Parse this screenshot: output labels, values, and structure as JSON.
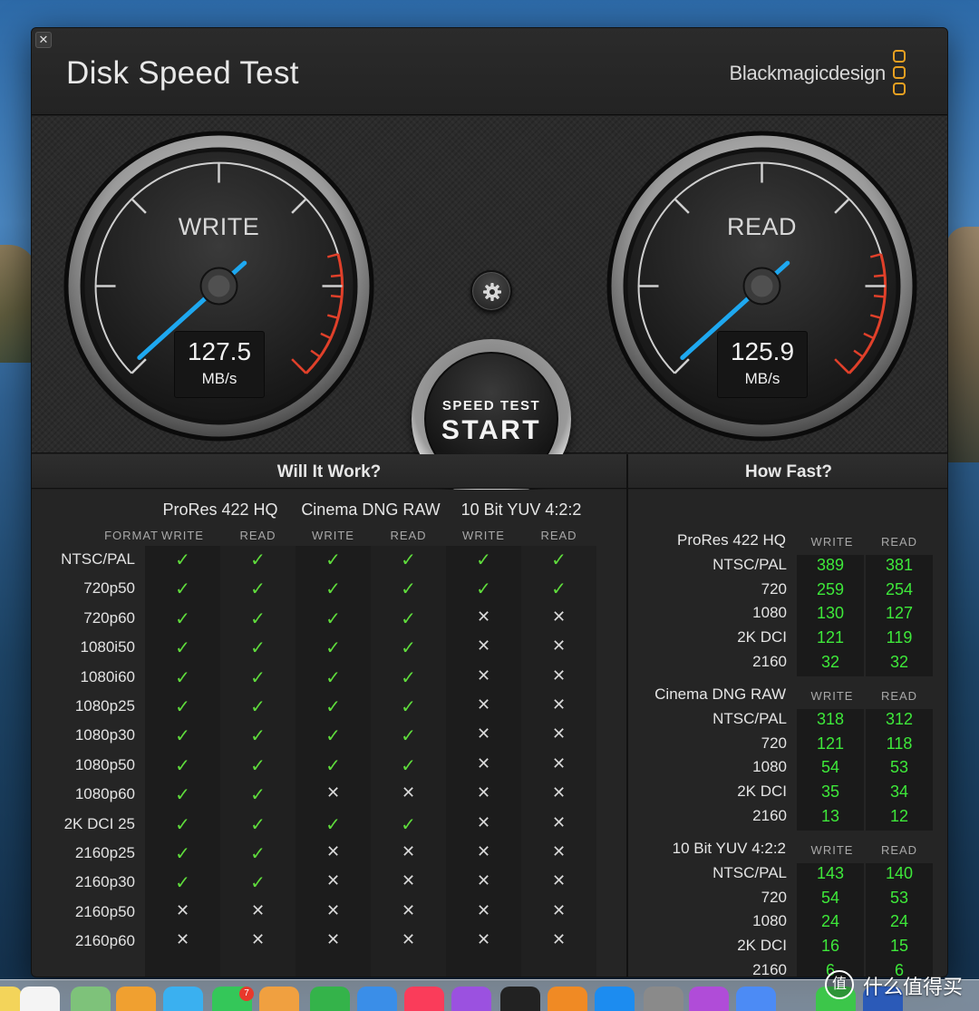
{
  "window": {
    "title": "Disk Speed Test",
    "brand": "Blackmagicdesign",
    "close_symbol": "✕"
  },
  "gauges": {
    "write": {
      "label": "WRITE",
      "value": "127.5",
      "unit": "MB/s"
    },
    "read": {
      "label": "READ",
      "value": "125.9",
      "unit": "MB/s"
    }
  },
  "controls": {
    "start_small": "SPEED TEST",
    "start_big": "START",
    "settings_icon": "gear-icon"
  },
  "will_it_work": {
    "title": "Will It Work?",
    "format_header": "FORMAT",
    "groups": [
      {
        "name": "ProRes 422 HQ",
        "write": "WRITE",
        "read": "READ"
      },
      {
        "name": "Cinema DNG RAW",
        "write": "WRITE",
        "read": "READ"
      },
      {
        "name": "10 Bit YUV 4:2:2",
        "write": "WRITE",
        "read": "READ"
      }
    ],
    "rows": [
      {
        "format": "NTSC/PAL",
        "marks": [
          "✓",
          "✓",
          "✓",
          "✓",
          "✓",
          "✓"
        ]
      },
      {
        "format": "720p50",
        "marks": [
          "✓",
          "✓",
          "✓",
          "✓",
          "✓",
          "✓"
        ]
      },
      {
        "format": "720p60",
        "marks": [
          "✓",
          "✓",
          "✓",
          "✓",
          "✕",
          "✕"
        ]
      },
      {
        "format": "1080i50",
        "marks": [
          "✓",
          "✓",
          "✓",
          "✓",
          "✕",
          "✕"
        ]
      },
      {
        "format": "1080i60",
        "marks": [
          "✓",
          "✓",
          "✓",
          "✓",
          "✕",
          "✕"
        ]
      },
      {
        "format": "1080p25",
        "marks": [
          "✓",
          "✓",
          "✓",
          "✓",
          "✕",
          "✕"
        ]
      },
      {
        "format": "1080p30",
        "marks": [
          "✓",
          "✓",
          "✓",
          "✓",
          "✕",
          "✕"
        ]
      },
      {
        "format": "1080p50",
        "marks": [
          "✓",
          "✓",
          "✓",
          "✓",
          "✕",
          "✕"
        ]
      },
      {
        "format": "1080p60",
        "marks": [
          "✓",
          "✓",
          "✕",
          "✕",
          "✕",
          "✕"
        ]
      },
      {
        "format": "2K DCI 25",
        "marks": [
          "✓",
          "✓",
          "✓",
          "✓",
          "✕",
          "✕"
        ]
      },
      {
        "format": "2160p25",
        "marks": [
          "✓",
          "✓",
          "✕",
          "✕",
          "✕",
          "✕"
        ]
      },
      {
        "format": "2160p30",
        "marks": [
          "✓",
          "✓",
          "✕",
          "✕",
          "✕",
          "✕"
        ]
      },
      {
        "format": "2160p50",
        "marks": [
          "✕",
          "✕",
          "✕",
          "✕",
          "✕",
          "✕"
        ]
      },
      {
        "format": "2160p60",
        "marks": [
          "✕",
          "✕",
          "✕",
          "✕",
          "✕",
          "✕"
        ]
      }
    ]
  },
  "how_fast": {
    "title": "How Fast?",
    "write_header": "WRITE",
    "read_header": "READ",
    "groups": [
      {
        "name": "ProRes 422 HQ",
        "rows": [
          {
            "label": "NTSC/PAL",
            "write": "389",
            "read": "381"
          },
          {
            "label": "720",
            "write": "259",
            "read": "254"
          },
          {
            "label": "1080",
            "write": "130",
            "read": "127"
          },
          {
            "label": "2K DCI",
            "write": "121",
            "read": "119"
          },
          {
            "label": "2160",
            "write": "32",
            "read": "32"
          }
        ]
      },
      {
        "name": "Cinema DNG RAW",
        "rows": [
          {
            "label": "NTSC/PAL",
            "write": "318",
            "read": "312"
          },
          {
            "label": "720",
            "write": "121",
            "read": "118"
          },
          {
            "label": "1080",
            "write": "54",
            "read": "53"
          },
          {
            "label": "2K DCI",
            "write": "35",
            "read": "34"
          },
          {
            "label": "2160",
            "write": "13",
            "read": "12"
          }
        ]
      },
      {
        "name": "10 Bit YUV 4:2:2",
        "rows": [
          {
            "label": "NTSC/PAL",
            "write": "143",
            "read": "140"
          },
          {
            "label": "720",
            "write": "54",
            "read": "53"
          },
          {
            "label": "1080",
            "write": "24",
            "read": "24"
          },
          {
            "label": "2K DCI",
            "write": "16",
            "read": "15"
          },
          {
            "label": "2160",
            "write": "6",
            "read": "6"
          }
        ]
      }
    ]
  },
  "dock": {
    "badge_count": "7",
    "watermark": "什么值得买",
    "watermark_icon": "值"
  },
  "colors": {
    "check": "#5fdc3c",
    "speed_value": "#3ee83a",
    "needle": "#1ea8f0",
    "redline": "#e0402a",
    "brand_logo": "#e8a021"
  }
}
